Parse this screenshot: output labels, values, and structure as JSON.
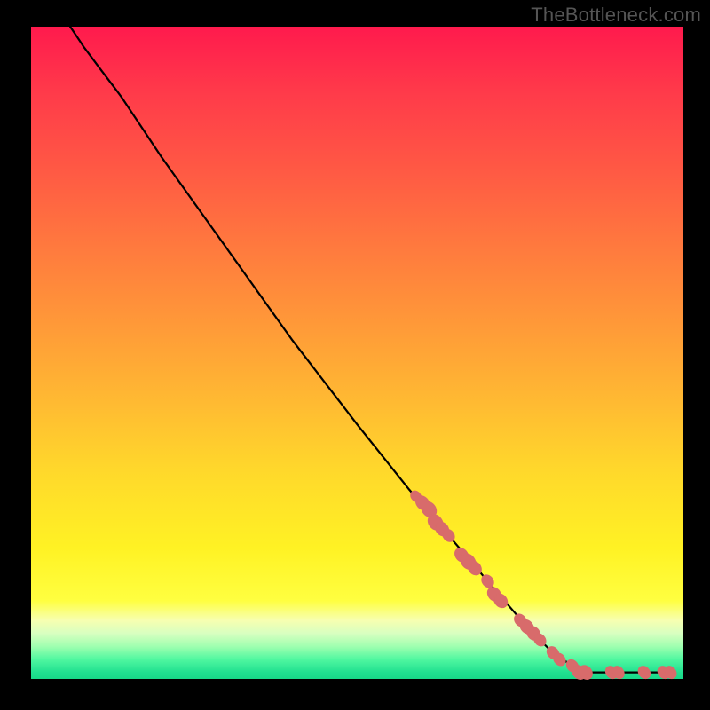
{
  "watermark": "TheBottleneck.com",
  "chart_data": {
    "type": "line",
    "title": "",
    "xlabel": "",
    "ylabel": "",
    "xlim": [
      0,
      100
    ],
    "ylim": [
      0,
      100
    ],
    "grid": false,
    "curve": [
      {
        "x": 6,
        "y": 100
      },
      {
        "x": 8,
        "y": 97
      },
      {
        "x": 11,
        "y": 93
      },
      {
        "x": 14,
        "y": 89
      },
      {
        "x": 20,
        "y": 80
      },
      {
        "x": 30,
        "y": 66
      },
      {
        "x": 40,
        "y": 52
      },
      {
        "x": 50,
        "y": 39
      },
      {
        "x": 58,
        "y": 29
      },
      {
        "x": 64,
        "y": 22
      },
      {
        "x": 70,
        "y": 15
      },
      {
        "x": 76,
        "y": 8
      },
      {
        "x": 80,
        "y": 4
      },
      {
        "x": 83,
        "y": 2
      },
      {
        "x": 86,
        "y": 1
      },
      {
        "x": 90,
        "y": 1
      },
      {
        "x": 94,
        "y": 1
      },
      {
        "x": 98,
        "y": 1
      }
    ],
    "markers": [
      {
        "x": 59,
        "y": 28,
        "size": 7
      },
      {
        "x": 60,
        "y": 27,
        "size": 9
      },
      {
        "x": 61,
        "y": 26,
        "size": 10
      },
      {
        "x": 62,
        "y": 24,
        "size": 10
      },
      {
        "x": 63,
        "y": 23,
        "size": 9
      },
      {
        "x": 64,
        "y": 22,
        "size": 8
      },
      {
        "x": 66,
        "y": 19,
        "size": 9
      },
      {
        "x": 67,
        "y": 18,
        "size": 10
      },
      {
        "x": 68,
        "y": 17,
        "size": 9
      },
      {
        "x": 70,
        "y": 15,
        "size": 8
      },
      {
        "x": 71,
        "y": 13,
        "size": 9
      },
      {
        "x": 72,
        "y": 12,
        "size": 9
      },
      {
        "x": 75,
        "y": 9,
        "size": 8
      },
      {
        "x": 76,
        "y": 8,
        "size": 9
      },
      {
        "x": 77,
        "y": 7,
        "size": 9
      },
      {
        "x": 78,
        "y": 6,
        "size": 8
      },
      {
        "x": 80,
        "y": 4,
        "size": 8
      },
      {
        "x": 81,
        "y": 3,
        "size": 8
      },
      {
        "x": 83,
        "y": 2,
        "size": 8
      },
      {
        "x": 84,
        "y": 1,
        "size": 9
      },
      {
        "x": 85,
        "y": 1,
        "size": 9
      },
      {
        "x": 89,
        "y": 1,
        "size": 8
      },
      {
        "x": 90,
        "y": 1,
        "size": 8
      },
      {
        "x": 94,
        "y": 1,
        "size": 8
      },
      {
        "x": 97,
        "y": 1,
        "size": 8
      },
      {
        "x": 98,
        "y": 1,
        "size": 8
      }
    ]
  }
}
